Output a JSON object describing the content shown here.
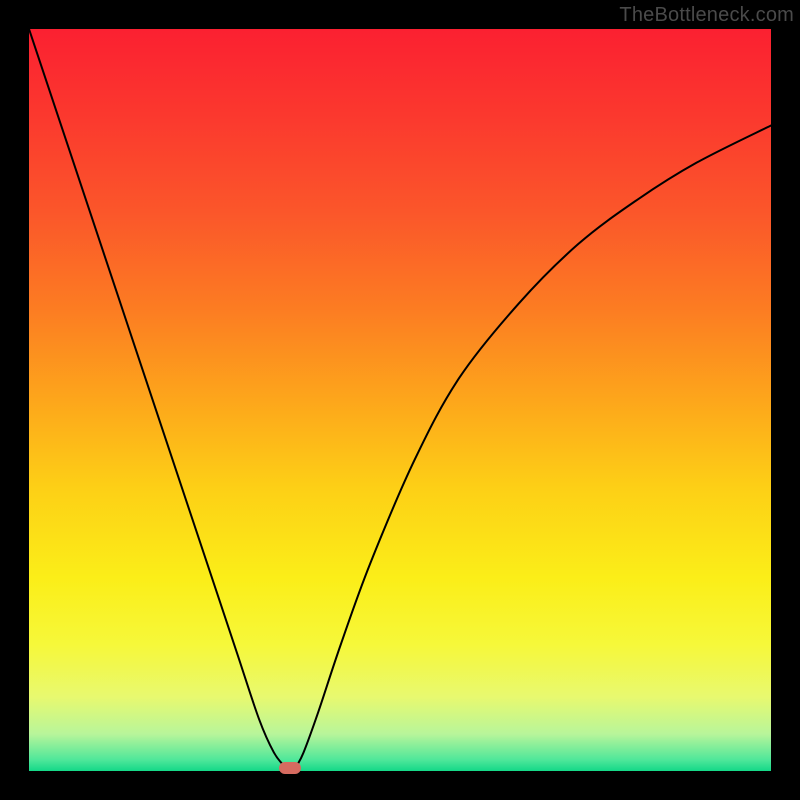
{
  "watermark": "TheBottleneck.com",
  "colors": {
    "gradient_stops": [
      {
        "offset": 0.0,
        "color": "#fb2031"
      },
      {
        "offset": 0.12,
        "color": "#fb392e"
      },
      {
        "offset": 0.25,
        "color": "#fb572a"
      },
      {
        "offset": 0.38,
        "color": "#fc7d22"
      },
      {
        "offset": 0.5,
        "color": "#fda61b"
      },
      {
        "offset": 0.62,
        "color": "#fdd016"
      },
      {
        "offset": 0.74,
        "color": "#fbee18"
      },
      {
        "offset": 0.83,
        "color": "#f6f83a"
      },
      {
        "offset": 0.9,
        "color": "#e8f96f"
      },
      {
        "offset": 0.95,
        "color": "#b8f59a"
      },
      {
        "offset": 0.985,
        "color": "#4fe79a"
      },
      {
        "offset": 1.0,
        "color": "#14d888"
      }
    ],
    "curve": "#000000",
    "marker": "#d66b60",
    "frame_bg": "#000000"
  },
  "chart_data": {
    "type": "line",
    "title": "",
    "xlabel": "",
    "ylabel": "",
    "xlim": [
      0,
      100
    ],
    "ylim": [
      0,
      100
    ],
    "grid": false,
    "legend": false,
    "annotations": [
      {
        "text": "TheBottleneck.com",
        "position": "top-right"
      }
    ],
    "series": [
      {
        "name": "bottleneck-curve",
        "x": [
          0,
          4,
          8,
          12,
          16,
          20,
          24,
          28,
          31,
          33,
          34.5,
          35.5,
          36,
          37,
          39,
          42,
          46,
          52,
          58,
          66,
          74,
          82,
          90,
          100
        ],
        "y": [
          100,
          88,
          76,
          64,
          52,
          40,
          28,
          16,
          7,
          2.5,
          0.6,
          0,
          0.6,
          2.5,
          8,
          17,
          28,
          42,
          53,
          63,
          71,
          77,
          82,
          87
        ]
      }
    ],
    "markers": [
      {
        "name": "optimal-point",
        "x": 35.2,
        "y": 0.4
      }
    ],
    "notes": "V-shaped bottleneck curve over a vertical red→green heat gradient. Minimum of the curve sits near x≈35 at y≈0 (green band). Left branch is near-linear; right branch is concave, flattening toward the top-right."
  }
}
